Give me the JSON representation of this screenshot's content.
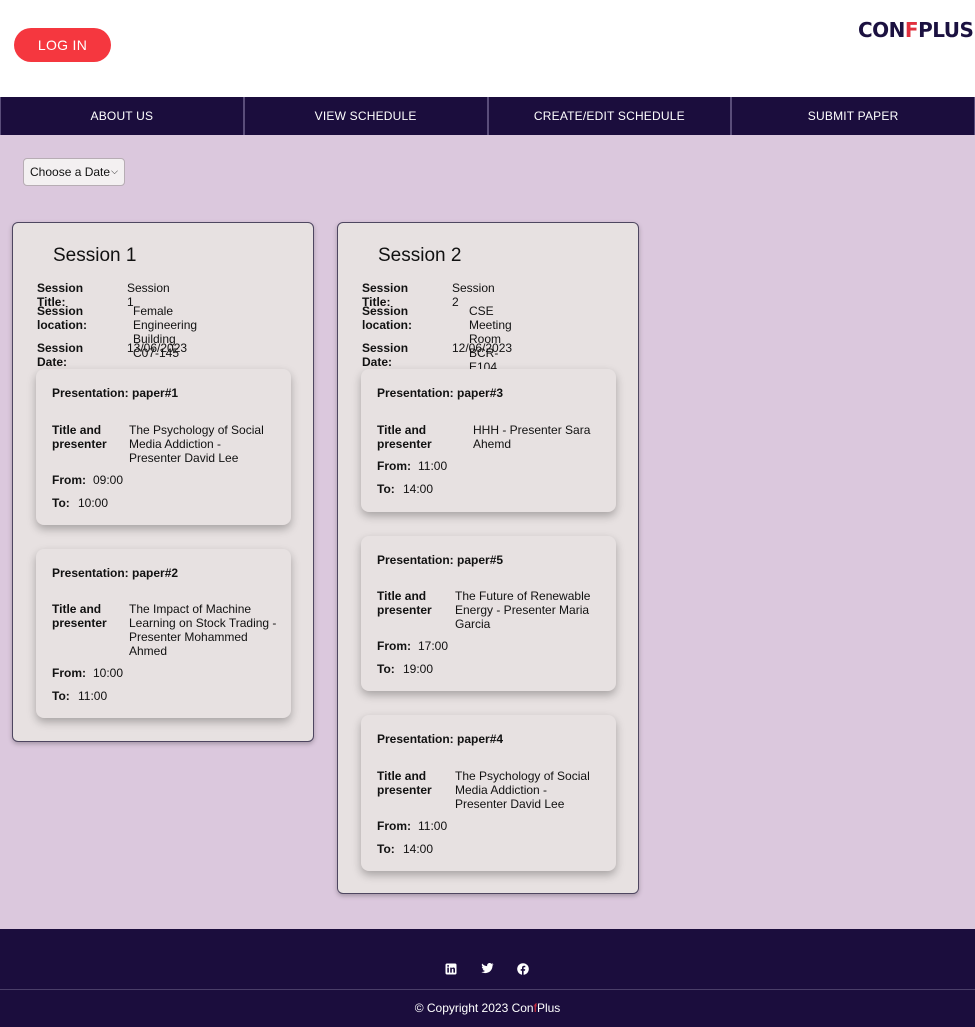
{
  "header": {
    "login_label": "LOG IN",
    "logo_pre": "CON",
    "logo_f": "F",
    "logo_post": "PLUS"
  },
  "nav": {
    "items": [
      "ABOUT US",
      "VIEW SCHEDULE",
      "CREATE/EDIT SCHEDULE",
      "SUBMIT PAPER"
    ]
  },
  "filter": {
    "date_select_value": "Choose a Date"
  },
  "labels": {
    "session_title": "Session Title:",
    "session_location_1": "Session",
    "session_location_2": "location:",
    "session_date": "Session Date:",
    "title_presenter_1": "Title and",
    "title_presenter_2": "presenter",
    "from": "From:",
    "to": "To:"
  },
  "sessions": [
    {
      "heading": "Session 1",
      "title": "Session 1",
      "location_1": "Female Engineering Building",
      "location_2": "C07-145",
      "date": "13/06/2023",
      "presentations": [
        {
          "label": "Presentation: paper#1",
          "title_lines": [
            "The Psychology of Social",
            "Media Addiction -",
            "Presenter David Lee"
          ],
          "from": "09:00",
          "to": "10:00"
        },
        {
          "label": "Presentation: paper#2",
          "title_lines": [
            "The Impact of Machine",
            "Learning on Stock Trading -",
            "Presenter Mohammed",
            "Ahmed"
          ],
          "from": "10:00",
          "to": "11:00"
        }
      ]
    },
    {
      "heading": "Session 2",
      "title": "Session 2",
      "location_1": "CSE Meeting Room BCR-",
      "location_2": "E104",
      "date": "12/06/2023",
      "presentations": [
        {
          "label": "Presentation: paper#3",
          "title_lines": [
            "HHH - Presenter Sara",
            "Ahemd"
          ],
          "from": "11:00",
          "to": "14:00"
        },
        {
          "label": "Presentation: paper#5",
          "title_lines": [
            "The Future of Renewable",
            "Energy - Presenter Maria",
            "Garcia"
          ],
          "from": "17:00",
          "to": "19:00"
        },
        {
          "label": "Presentation: paper#4",
          "title_lines": [
            "The Psychology of Social",
            "Media Addiction -",
            "Presenter David Lee"
          ],
          "from": "11:00",
          "to": "14:00"
        }
      ]
    }
  ],
  "footer": {
    "social_icons": [
      "linkedin-icon",
      "twitter-icon",
      "facebook-icon"
    ],
    "copyright_pre": "© Copyright 2023 Con",
    "copyright_f": "f",
    "copyright_post": "Plus"
  }
}
